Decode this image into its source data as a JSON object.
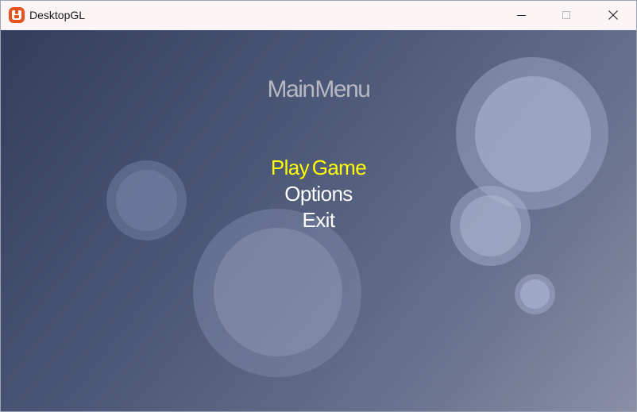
{
  "window": {
    "title": "DesktopGL",
    "icon": "monogame-logo-icon",
    "controls": [
      "minimize-icon",
      "maximize-icon",
      "close-icon"
    ]
  },
  "game": {
    "title": "Main Menu",
    "menu_items": [
      {
        "label": "Play Game",
        "selected": true,
        "color": "#ffff00"
      },
      {
        "label": "Options",
        "selected": false,
        "color": "#ffffff"
      },
      {
        "label": "Exit",
        "selected": false,
        "color": "#ffffff"
      }
    ],
    "background": {
      "gradient_start": "#323e5c",
      "gradient_end": "#8a8fa6"
    }
  }
}
